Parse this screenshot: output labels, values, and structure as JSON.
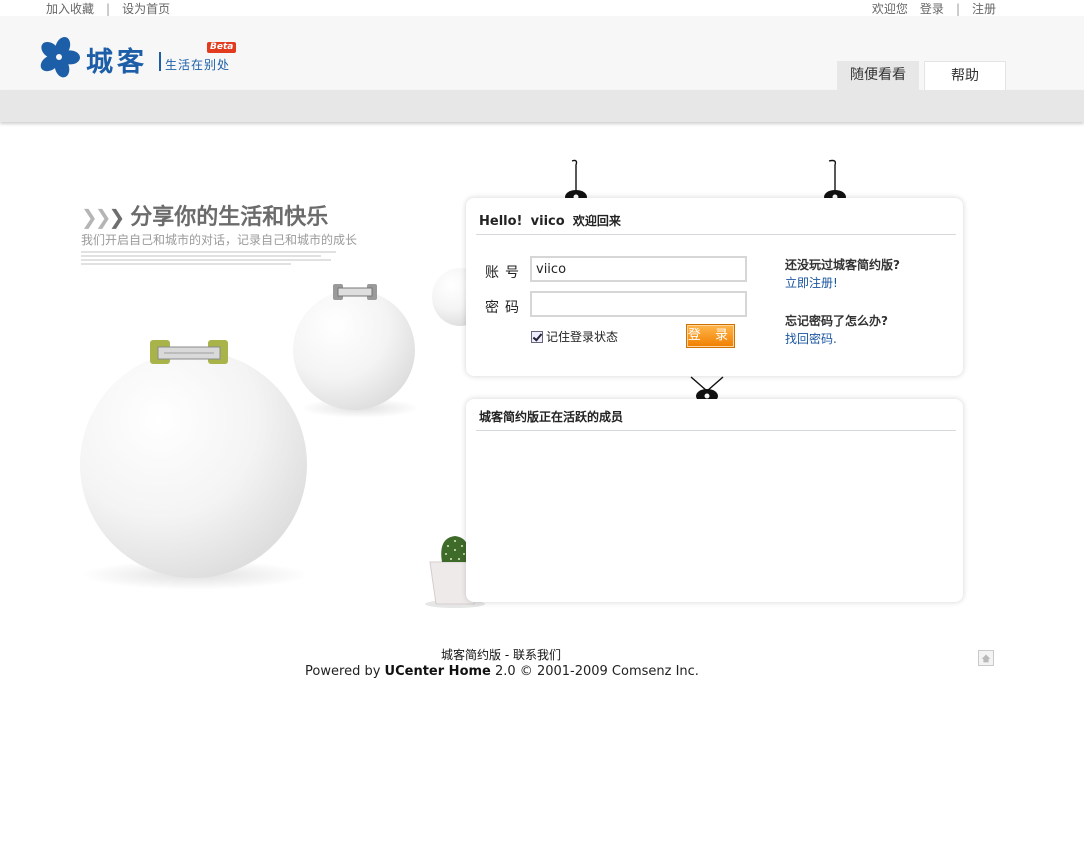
{
  "topbar": {
    "bookmark": "加入收藏",
    "set_home": "设为首页",
    "welcome": "欢迎您",
    "login": "登录",
    "register": "注册"
  },
  "logo": {
    "brand": "城客",
    "slogan": "生活在别处",
    "beta": "Beta"
  },
  "nav": {
    "random": "随便看看",
    "help": "帮助"
  },
  "hero": {
    "title": "分享你的生活和快乐",
    "subtitle": "我们开启自己和城市的对话，记录自己和城市的成长"
  },
  "login_panel": {
    "hello": "Hello!",
    "username": "viico",
    "welcome_back": "欢迎回来",
    "account_label": "账号",
    "password_label": "密码",
    "account_value": "viico",
    "password_value": "",
    "remember_label": "记住登录状态",
    "remember_checked": true,
    "login_button": "登 录",
    "no_account_q": "还没玩过城客简约版?",
    "register_link": "立即注册!",
    "forgot_q": "忘记密码了怎么办?",
    "forgot_link": "找回密码."
  },
  "active_panel": {
    "title": "城客简约版正在活跃的成员"
  },
  "footer": {
    "site_link": "城客简约版",
    "separator": "-",
    "contact_link": "联系我们",
    "powered_prefix": "Powered by",
    "powered_product": "UCenter Home",
    "powered_suffix": "2.0 © 2001-2009 Comsenz Inc."
  },
  "colors": {
    "brand_blue": "#1c5fa8",
    "link_blue": "#1a55a0",
    "button_orange": "#f07f00",
    "beta_red": "#e23b1d"
  },
  "icons": {
    "logo": "flower-logo-icon",
    "back_to_top": "home-up-icon"
  }
}
